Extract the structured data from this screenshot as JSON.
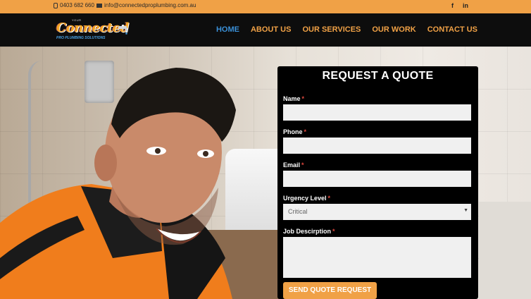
{
  "topbar": {
    "phone": "0403 682 660",
    "email": "info@connectedproplumbing.com.au",
    "social": [
      {
        "name": "facebook-icon",
        "glyph": "f"
      },
      {
        "name": "linkedin-icon",
        "glyph": "in"
      }
    ]
  },
  "brand": {
    "small_text": "YOUR",
    "name": "Connected",
    "tagline": "PRO PLUMBING SOLUTIONS"
  },
  "nav": {
    "items": [
      {
        "label": "HOME",
        "active": true
      },
      {
        "label": "ABOUT US",
        "active": false
      },
      {
        "label": "OUR SERVICES",
        "active": false
      },
      {
        "label": "OUR WORK",
        "active": false
      },
      {
        "label": "CONTACT US",
        "active": false
      }
    ]
  },
  "quote_form": {
    "title": "REQUEST A QUOTE",
    "fields": {
      "name": {
        "label": "Name",
        "value": ""
      },
      "phone": {
        "label": "Phone",
        "value": ""
      },
      "email": {
        "label": "Email",
        "value": ""
      },
      "urgency": {
        "label": "Urgency Level",
        "value": "Critical"
      },
      "description": {
        "label": "Job Descirption",
        "value": ""
      }
    },
    "required_marker": "*",
    "submit_label": "SEND QUOTE REQUEST"
  },
  "colors": {
    "accent_orange": "#f0a146",
    "nav_active_blue": "#3a8fd6",
    "header_bg": "#0d0d0d"
  }
}
